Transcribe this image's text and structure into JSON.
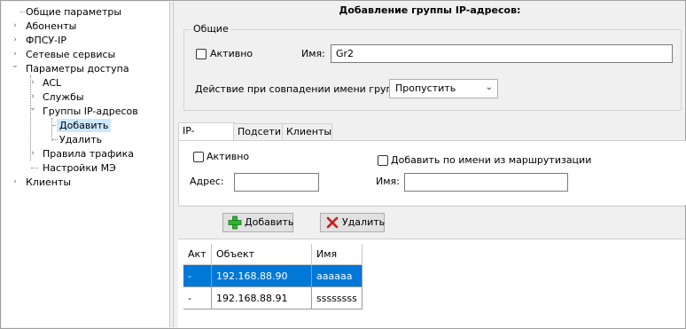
{
  "tree": {
    "items": [
      {
        "label": "Общие параметры",
        "expander": ""
      },
      {
        "label": "Абоненты",
        "expander": "›"
      },
      {
        "label": "ФПСУ-IP",
        "expander": "›"
      },
      {
        "label": "Сетевые сервисы",
        "expander": "›"
      },
      {
        "label": "Параметры доступа",
        "expander": "⌄"
      },
      {
        "label": "ACL",
        "expander": "›"
      },
      {
        "label": "Службы",
        "expander": "›"
      },
      {
        "label": "Группы IP-адресов",
        "expander": "⌄"
      },
      {
        "label": "Добавить",
        "expander": ""
      },
      {
        "label": "Удалить",
        "expander": ""
      },
      {
        "label": "Правила трафика",
        "expander": "›"
      },
      {
        "label": "Настройки МЭ",
        "expander": ""
      },
      {
        "label": "Клиенты",
        "expander": "›"
      }
    ]
  },
  "form": {
    "title": "Добавление группы IP-адресов:",
    "group_caption": "Общие",
    "active_label": "Активно",
    "name_label": "Имя:",
    "name_value": "Gr2",
    "action_label": "Действие при совпадении имени группы:",
    "action_value": "Пропустить"
  },
  "tabs": [
    "IP-адреса",
    "Подсети",
    "Клиенты"
  ],
  "ip_tab": {
    "active_label": "Активно",
    "route_label": "Добавить по имени из маршрутизации",
    "address_label": "Адрес:",
    "address_value": "",
    "name_label": "Имя:",
    "name_value": ""
  },
  "buttons": {
    "add": "Добавить",
    "delete": "Удалить"
  },
  "grid": {
    "columns": [
      "Акт",
      "Объект",
      "Имя"
    ],
    "rows": [
      {
        "act": "-",
        "object": "192.168.88.90",
        "name": "aaaaaa"
      },
      {
        "act": "-",
        "object": "192.168.88.91",
        "name": "ssssssss"
      }
    ]
  },
  "colors": {
    "selection": "#0078d7",
    "tree_selection": "#cde8ff"
  },
  "icons": {
    "add": "plus-icon",
    "delete": "x-icon"
  }
}
